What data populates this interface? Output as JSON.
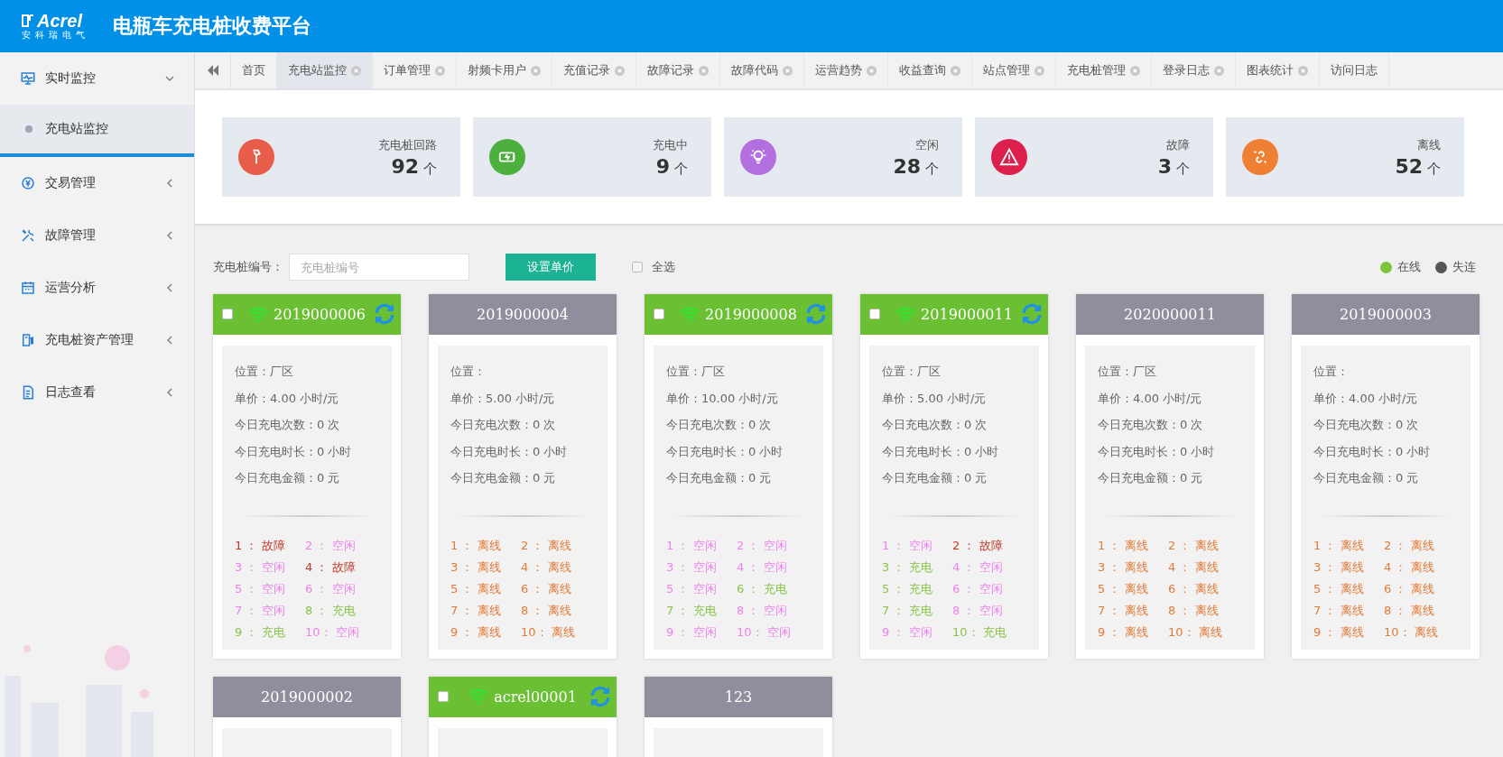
{
  "header": {
    "logo_text": "Acrel",
    "logo_subtext": "安科瑞电气",
    "title": "电瓶车充电桩收费平台"
  },
  "sidebar": {
    "items": [
      {
        "label": "实时监控",
        "kind": "monitor",
        "expanded": true,
        "children": [
          {
            "label": "充电站监控",
            "selected": true
          }
        ]
      },
      {
        "label": "交易管理",
        "kind": "yuan",
        "expanded": false
      },
      {
        "label": "故障管理",
        "kind": "tools",
        "expanded": false
      },
      {
        "label": "运营分析",
        "kind": "calendar",
        "expanded": false
      },
      {
        "label": "充电桩资产管理",
        "kind": "pump",
        "expanded": false
      },
      {
        "label": "日志查看",
        "kind": "log",
        "expanded": false
      }
    ]
  },
  "tabs": [
    {
      "label": "首页",
      "selected": false,
      "closable": false
    },
    {
      "label": "充电站监控",
      "selected": true,
      "closable": true
    },
    {
      "label": "订单管理",
      "selected": false,
      "closable": true
    },
    {
      "label": "射频卡用户",
      "selected": false,
      "closable": true
    },
    {
      "label": "充值记录",
      "selected": false,
      "closable": true
    },
    {
      "label": "故障记录",
      "selected": false,
      "closable": true
    },
    {
      "label": "故障代码",
      "selected": false,
      "closable": true
    },
    {
      "label": "运营趋势",
      "selected": false,
      "closable": true
    },
    {
      "label": "收益查询",
      "selected": false,
      "closable": true
    },
    {
      "label": "站点管理",
      "selected": false,
      "closable": true
    },
    {
      "label": "充电桩管理",
      "selected": false,
      "closable": true
    },
    {
      "label": "登录日志",
      "selected": false,
      "closable": true
    },
    {
      "label": "图表统计",
      "selected": false,
      "closable": true
    },
    {
      "label": "访问日志",
      "selected": false,
      "closable": false
    }
  ],
  "stats": [
    {
      "kind": "plug",
      "label": "充电桩回路",
      "value": "92",
      "unit": "个",
      "color": "#e85c4a"
    },
    {
      "kind": "battery",
      "label": "充电中",
      "value": "9",
      "unit": "个",
      "color": "#4caf3e"
    },
    {
      "kind": "bulb",
      "label": "空闲",
      "value": "28",
      "unit": "个",
      "color": "#b36ee0"
    },
    {
      "kind": "warning",
      "label": "故障",
      "value": "3",
      "unit": "个",
      "color": "#dc1f4c"
    },
    {
      "kind": "link",
      "label": "离线",
      "value": "52",
      "unit": "个",
      "color": "#ee7f33"
    }
  ],
  "filter": {
    "label": "充电桩编号：",
    "placeholder": "充电桩编号",
    "button": "设置单价",
    "select_all": {
      "label": "全选",
      "checked": false
    }
  },
  "legend": [
    {
      "label": "在线",
      "color": "#7cc53a"
    },
    {
      "label": "失连",
      "color": "#555555"
    }
  ],
  "cards": [
    {
      "id": "2019000006",
      "online": true,
      "checked": false,
      "info": [
        "位置：厂区",
        "单价：4.00 小时/元",
        "今日充电次数：0 次",
        "今日充电时长：0 小时",
        "今日充电金额：0 元"
      ],
      "ports": [
        {
          "label": "1 ： 故障",
          "color": "#c0392b"
        },
        {
          "label": "2 ： 空闲",
          "color": "#ee82ee"
        },
        {
          "label": "3 ： 空闲",
          "color": "#ee82ee"
        },
        {
          "label": "4 ： 故障",
          "color": "#c0392b"
        },
        {
          "label": "5 ： 空闲",
          "color": "#ee82ee"
        },
        {
          "label": "6 ： 空闲",
          "color": "#ee82ee"
        },
        {
          "label": "7 ： 空闲",
          "color": "#ee82ee"
        },
        {
          "label": "8 ： 充电",
          "color": "#8bc34a"
        },
        {
          "label": "9 ： 充电",
          "color": "#8bc34a"
        },
        {
          "label": "10： 空闲",
          "color": "#ee82ee"
        }
      ]
    },
    {
      "id": "2019000004",
      "online": false,
      "info": [
        "位置：",
        "单价：5.00 小时/元",
        "今日充电次数：0 次",
        "今日充电时长：0 小时",
        "今日充电金额：0 元"
      ],
      "ports": [
        {
          "label": "1 ： 离线",
          "color": "#e07b39"
        },
        {
          "label": "2 ： 离线",
          "color": "#e07b39"
        },
        {
          "label": "3 ： 离线",
          "color": "#e07b39"
        },
        {
          "label": "4 ： 离线",
          "color": "#e07b39"
        },
        {
          "label": "5 ： 离线",
          "color": "#e07b39"
        },
        {
          "label": "6 ： 离线",
          "color": "#e07b39"
        },
        {
          "label": "7 ： 离线",
          "color": "#e07b39"
        },
        {
          "label": "8 ： 离线",
          "color": "#e07b39"
        },
        {
          "label": "9 ： 离线",
          "color": "#e07b39"
        },
        {
          "label": "10： 离线",
          "color": "#e07b39"
        }
      ]
    },
    {
      "id": "2019000008",
      "online": true,
      "checked": false,
      "info": [
        "位置：厂区",
        "单价：10.00 小时/元",
        "今日充电次数：0 次",
        "今日充电时长：0 小时",
        "今日充电金额：0 元"
      ],
      "ports": [
        {
          "label": "1 ： 空闲",
          "color": "#ee82ee"
        },
        {
          "label": "2 ： 空闲",
          "color": "#ee82ee"
        },
        {
          "label": "3 ： 空闲",
          "color": "#ee82ee"
        },
        {
          "label": "4 ： 空闲",
          "color": "#ee82ee"
        },
        {
          "label": "5 ： 空闲",
          "color": "#ee82ee"
        },
        {
          "label": "6 ： 充电",
          "color": "#8bc34a"
        },
        {
          "label": "7 ： 充电",
          "color": "#8bc34a"
        },
        {
          "label": "8 ： 空闲",
          "color": "#ee82ee"
        },
        {
          "label": "9 ： 空闲",
          "color": "#ee82ee"
        },
        {
          "label": "10： 空闲",
          "color": "#ee82ee"
        }
      ]
    },
    {
      "id": "2019000011",
      "online": true,
      "checked": false,
      "info": [
        "位置：厂区",
        "单价：5.00 小时/元",
        "今日充电次数：0 次",
        "今日充电时长：0 小时",
        "今日充电金额：0 元"
      ],
      "ports": [
        {
          "label": "1 ： 空闲",
          "color": "#ee82ee"
        },
        {
          "label": "2 ： 故障",
          "color": "#c0392b"
        },
        {
          "label": "3 ： 充电",
          "color": "#8bc34a"
        },
        {
          "label": "4 ： 空闲",
          "color": "#ee82ee"
        },
        {
          "label": "5 ： 充电",
          "color": "#8bc34a"
        },
        {
          "label": "6 ： 空闲",
          "color": "#ee82ee"
        },
        {
          "label": "7 ： 充电",
          "color": "#8bc34a"
        },
        {
          "label": "8 ： 空闲",
          "color": "#ee82ee"
        },
        {
          "label": "9 ： 空闲",
          "color": "#ee82ee"
        },
        {
          "label": "10： 充电",
          "color": "#8bc34a"
        }
      ]
    },
    {
      "id": "2020000011",
      "online": false,
      "info": [
        "位置：厂区",
        "单价：4.00 小时/元",
        "今日充电次数：0 次",
        "今日充电时长：0 小时",
        "今日充电金额：0 元"
      ],
      "ports": [
        {
          "label": "1 ： 离线",
          "color": "#e07b39"
        },
        {
          "label": "2 ： 离线",
          "color": "#e07b39"
        },
        {
          "label": "3 ： 离线",
          "color": "#e07b39"
        },
        {
          "label": "4 ： 离线",
          "color": "#e07b39"
        },
        {
          "label": "5 ： 离线",
          "color": "#e07b39"
        },
        {
          "label": "6 ： 离线",
          "color": "#e07b39"
        },
        {
          "label": "7 ： 离线",
          "color": "#e07b39"
        },
        {
          "label": "8 ： 离线",
          "color": "#e07b39"
        },
        {
          "label": "9 ： 离线",
          "color": "#e07b39"
        },
        {
          "label": "10： 离线",
          "color": "#e07b39"
        }
      ]
    },
    {
      "id": "2019000003",
      "online": false,
      "info": [
        "位置：",
        "单价：4.00 小时/元",
        "今日充电次数：0 次",
        "今日充电时长：0 小时",
        "今日充电金额：0 元"
      ],
      "ports": [
        {
          "label": "1 ： 离线",
          "color": "#e07b39"
        },
        {
          "label": "2 ： 离线",
          "color": "#e07b39"
        },
        {
          "label": "3 ： 离线",
          "color": "#e07b39"
        },
        {
          "label": "4 ： 离线",
          "color": "#e07b39"
        },
        {
          "label": "5 ： 离线",
          "color": "#e07b39"
        },
        {
          "label": "6 ： 离线",
          "color": "#e07b39"
        },
        {
          "label": "7 ： 离线",
          "color": "#e07b39"
        },
        {
          "label": "8 ： 离线",
          "color": "#e07b39"
        },
        {
          "label": "9 ： 离线",
          "color": "#e07b39"
        },
        {
          "label": "10： 离线",
          "color": "#e07b39"
        }
      ]
    },
    {
      "id": "2019000002",
      "online": false
    },
    {
      "id": "acrel00001",
      "online": true,
      "checked": false
    },
    {
      "id": "123",
      "online": false
    }
  ]
}
